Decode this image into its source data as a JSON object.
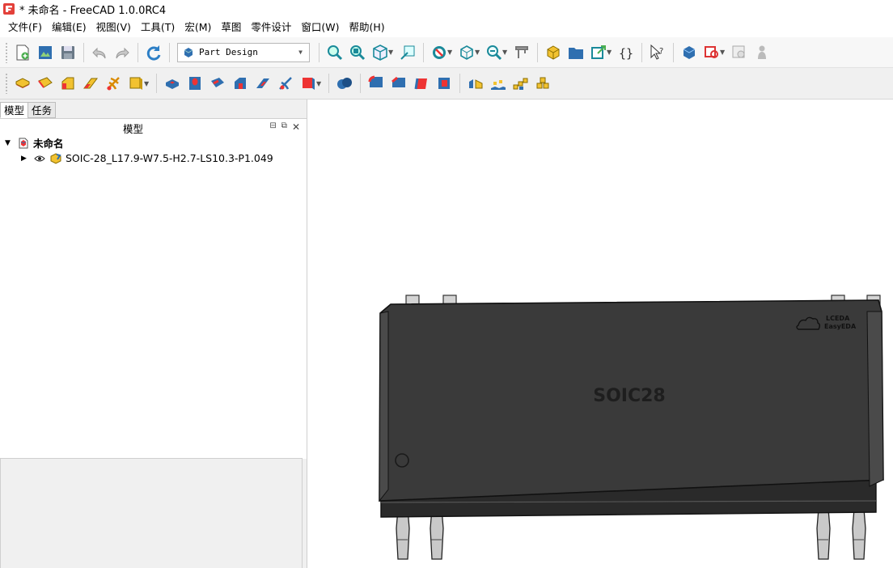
{
  "window": {
    "title": "* 未命名 - FreeCAD 1.0.0RC4",
    "app_icon": "freecad-icon"
  },
  "menubar": {
    "items": [
      "文件(F)",
      "编辑(E)",
      "视图(V)",
      "工具(T)",
      "宏(M)",
      "草图",
      "零件设计",
      "窗口(W)",
      "帮助(H)"
    ]
  },
  "toolbar": {
    "workbench_selector": "Part Design"
  },
  "left_panel": {
    "tabs": [
      "模型",
      "任务"
    ],
    "active_tab": "模型",
    "model_panel_title": "模型",
    "tree": {
      "root": "未命名",
      "children": [
        "SOIC-28_L17.9-W7.5-H2.7-LS10.3-P1.049"
      ]
    }
  },
  "viewport": {
    "body_text": "SOIC28",
    "logo_text_line1": "LCEDA",
    "logo_text_line2": "EasyEDA",
    "body_color": "#3a3a3a",
    "pin_color": "#c9c9c9"
  }
}
